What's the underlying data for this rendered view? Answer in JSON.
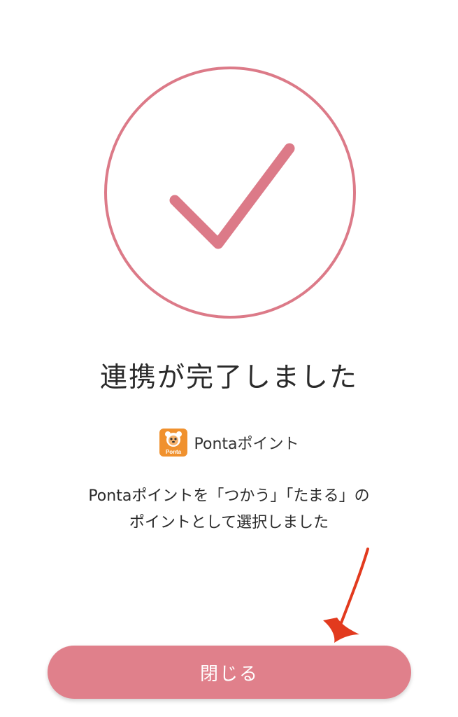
{
  "success": {
    "icon": "check-circle-icon",
    "accent_color": "#dc7a88",
    "title": "連携が完了しました"
  },
  "service": {
    "logo": "ponta-logo-icon",
    "logo_text": "Ponta",
    "name": "Pontaポイント",
    "logo_color": "#f0912e"
  },
  "message": {
    "line1": "Pontaポイントを「つかう」「たまる」の",
    "line2": "ポイントとして選択しました"
  },
  "actions": {
    "close_label": "閉じる",
    "button_color": "#e0808b"
  },
  "annotation": {
    "icon": "red-arrow-icon",
    "color": "#e23a1e"
  }
}
